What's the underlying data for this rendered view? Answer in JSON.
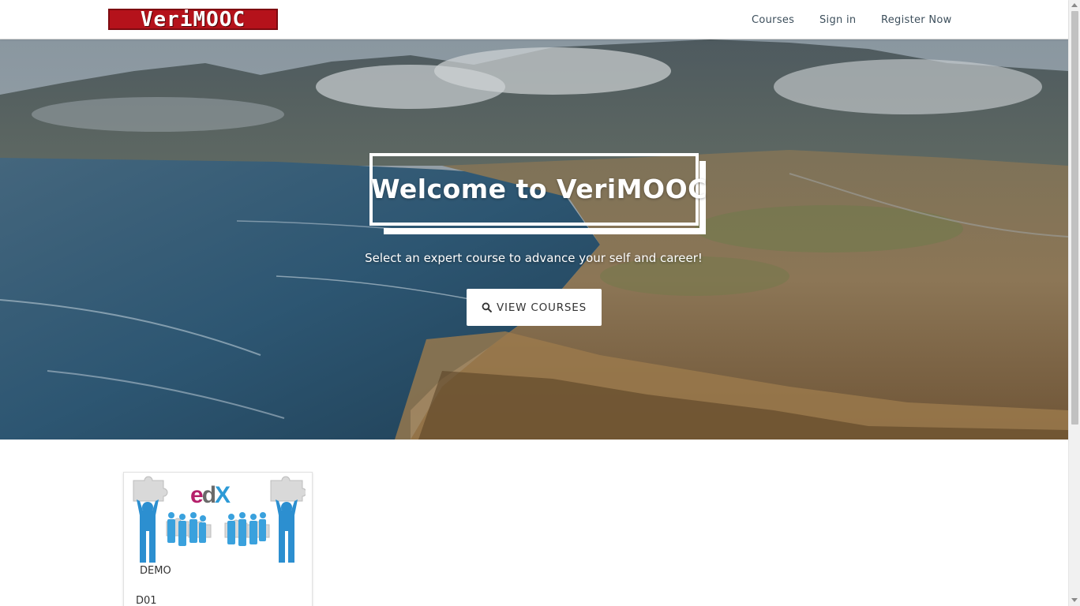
{
  "header": {
    "logo_text": "VeriMOOC",
    "nav": {
      "courses": "Courses",
      "sign_in": "Sign in",
      "register": "Register Now"
    }
  },
  "hero": {
    "title": "Welcome to VeriMOOC",
    "subtitle": "Select an expert course to advance your self and career!",
    "button_label": "VIEW COURSES",
    "button_icon": "search-icon"
  },
  "courses": [
    {
      "image_brand": "edX",
      "image_label": "DEMO",
      "code": "D01"
    }
  ],
  "colors": {
    "logo_red": "#b5121b",
    "nav_text": "#3d4f5c",
    "edx_magenta": "#b5206b",
    "edx_blue": "#2c9ad6"
  }
}
